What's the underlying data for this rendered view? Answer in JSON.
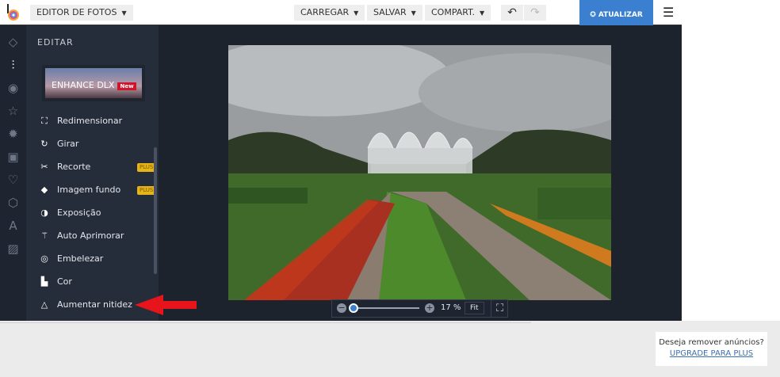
{
  "header": {
    "app_menu": "EDITOR DE FOTOS",
    "load": "CARREGAR",
    "save": "SALVAR",
    "share": "COMPART.",
    "update": "ATUALIZAR",
    "undo_icon": "undo-icon",
    "redo_icon": "redo-icon",
    "menu_icon": "hamburger-icon"
  },
  "rail_icons": [
    "layers-icon",
    "sliders-icon",
    "eye-icon",
    "star-icon",
    "badge-icon",
    "frame-icon",
    "heart-icon",
    "shape-icon",
    "text-icon",
    "texture-icon"
  ],
  "panel": {
    "title": "EDITAR",
    "banner": {
      "label": "ENHANCE DLX",
      "badge": "New"
    },
    "items": [
      {
        "label": "Redimensionar",
        "icon": "resize-icon"
      },
      {
        "label": "Girar",
        "icon": "rotate-icon"
      },
      {
        "label": "Recorte",
        "icon": "cutout-icon",
        "badge": "PLUS"
      },
      {
        "label": "Imagem fundo",
        "icon": "eraser-icon",
        "badge": "PLUS"
      },
      {
        "label": "Exposição",
        "icon": "exposure-icon"
      },
      {
        "label": "Auto Aprimorar",
        "icon": "magic-wand-icon"
      },
      {
        "label": "Embelezar",
        "icon": "beautify-icon"
      },
      {
        "label": "Cor",
        "icon": "color-icon"
      },
      {
        "label": "Aumentar nitidez",
        "icon": "triangle-icon"
      }
    ]
  },
  "zoom": {
    "value": "17 %",
    "fit": "Fit",
    "slider_percent": 5
  },
  "ad": {
    "text": "Deseja remover anúncios?",
    "link": "UPGRADE PARA PLUS"
  },
  "colors": {
    "accent": "#3b7fd0",
    "plus_badge": "#e6b417",
    "new_badge": "#d0142a",
    "arrow": "#e8141c"
  }
}
